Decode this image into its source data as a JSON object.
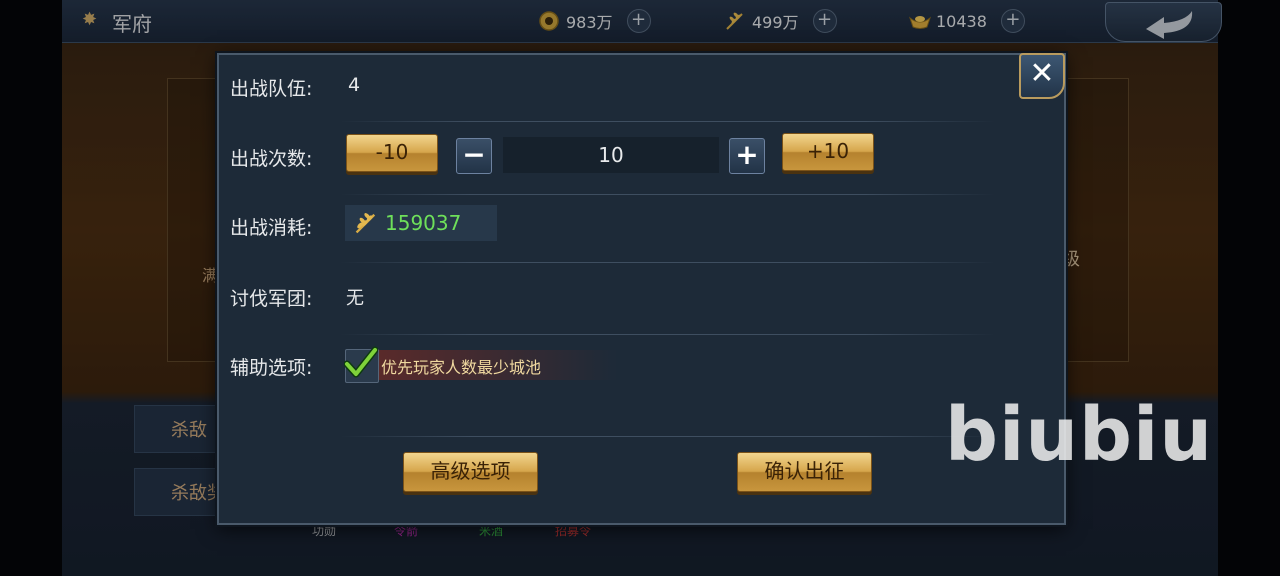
{
  "header": {
    "title": "军府",
    "resources": [
      {
        "icon": "coin-icon",
        "value": "983万"
      },
      {
        "icon": "grain-icon",
        "value": "499万"
      },
      {
        "icon": "gold-ingot-icon",
        "value": "10438"
      }
    ]
  },
  "background": {
    "side_label": "级",
    "left_cut": "满",
    "panel1_text": "杀敌",
    "panel2_text": "杀敌奖",
    "footer_labels": [
      "功勋",
      "令箭",
      "米酒",
      "招募令"
    ]
  },
  "dialog": {
    "team_label": "出战队伍:",
    "team_value": "4",
    "count_label": "出战次数:",
    "minus10_label": "-10",
    "minus_label": "−",
    "count_value": "10",
    "plus_label": "+",
    "plus10_label": "+10",
    "cost_label": "出战消耗:",
    "cost_icon": "grain-icon",
    "cost_value": "159037",
    "legion_label": "讨伐军团:",
    "legion_value": "无",
    "assist_label": "辅助选项:",
    "assist_option": "优先玩家人数最少城池",
    "assist_checked": true,
    "advanced_button": "高级选项",
    "confirm_button": "确认出征",
    "close_icon": "close-icon"
  },
  "watermark": "biubiu",
  "colors": {
    "cost_value": "#6ee05a",
    "gold_button": "#d6a64c",
    "panel_bg": "#1d2a38"
  }
}
